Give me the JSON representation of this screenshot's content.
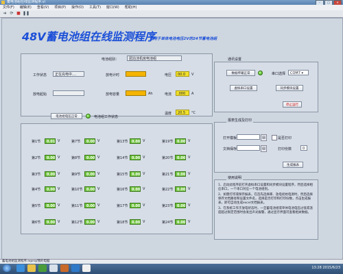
{
  "window": {
    "title": "蓄电池组在线监测程序.vi"
  },
  "menu": [
    "文件(F)",
    "编辑(E)",
    "查看(V)",
    "项目(P)",
    "操作(O)",
    "工具(T)",
    "窗口(W)",
    "帮助(H)"
  ],
  "header": {
    "title": "48V蓄电池组在线监测程序",
    "subtitle": "适用于单体电池电压2V的24节蓄电池组"
  },
  "battery_group": {
    "label": "电池组别：",
    "value": "团泊洼机房电池组"
  },
  "status": {
    "work_status_label": "工作状态",
    "work_status_value": "正在充电中....",
    "discharge_start_label": "放电起始",
    "discharge_timer_label": "放电计时",
    "discharge_capacity_label": "放电容量",
    "discharge_capacity_unit": "Ah",
    "voltage_label": "电压",
    "voltage_value": "00.0",
    "voltage_unit": "V",
    "current_label": "电流",
    "current_value": ".000",
    "current_unit": "A",
    "temp_label": "温度",
    "temp_value": "20.5",
    "temp_unit": "°C",
    "normal_button": "电池组电压正常",
    "work_state_text": "电池组工作状态"
  },
  "cells": [
    {
      "label": "第1节",
      "value": "0.01",
      "unit": "V"
    },
    {
      "label": "第2节",
      "value": "0.00",
      "unit": "V"
    },
    {
      "label": "第3节",
      "value": "0.00",
      "unit": "V"
    },
    {
      "label": "第4节",
      "value": "0.00",
      "unit": "V"
    },
    {
      "label": "第5节",
      "value": "0.00",
      "unit": "V"
    },
    {
      "label": "第6节",
      "value": "0.00",
      "unit": "V"
    },
    {
      "label": "第7节",
      "value": "0.00",
      "unit": "V"
    },
    {
      "label": "第8节",
      "value": "0.00",
      "unit": "V"
    },
    {
      "label": "第9节",
      "value": "0.00",
      "unit": "V"
    },
    {
      "label": "第10节",
      "value": "0.00",
      "unit": "V"
    },
    {
      "label": "第11节",
      "value": "0.00",
      "unit": "V"
    },
    {
      "label": "第12节",
      "value": "0.00",
      "unit": "V"
    },
    {
      "label": "第13节",
      "value": "0.00",
      "unit": "V"
    },
    {
      "label": "第14节",
      "value": "0.00",
      "unit": "V"
    },
    {
      "label": "第15节",
      "value": "0.00",
      "unit": "V"
    },
    {
      "label": "第16节",
      "value": "0.00",
      "unit": "V"
    },
    {
      "label": "第17节",
      "value": "0.00",
      "unit": "V"
    },
    {
      "label": "第18节",
      "value": "0.00",
      "unit": "V"
    },
    {
      "label": "第19节",
      "value": "0.00",
      "unit": "V"
    },
    {
      "label": "第20节",
      "value": "0.00",
      "unit": "V"
    },
    {
      "label": "第21节",
      "value": "0.00",
      "unit": "V"
    },
    {
      "label": "第22节",
      "value": "0.00",
      "unit": "V"
    },
    {
      "label": "第23节",
      "value": "0.00",
      "unit": "V"
    },
    {
      "label": "第24节",
      "value": "0.00",
      "unit": "V"
    }
  ],
  "comm": {
    "title": "通讯设置",
    "data_status_button": "数据传输正常",
    "port_label": "串口选择",
    "port_value": "COM7",
    "virtual_port_button": "虚拟串口设置",
    "sync_button": "同步模块设置",
    "stop_button": "停止运行"
  },
  "report": {
    "title": "报表生成及打印",
    "template_label": "打开模板",
    "save_label": "文档保存",
    "print_label": "是否打印",
    "copies_label": "打印份数",
    "copies_value": "0",
    "generate_button": "生成报表"
  },
  "help": {
    "title": "使用说明",
    "lines": [
      "1、启动此程序前打开虚拟串口设置和同步模块设置程序，然后选择相应串口，一个串口对应一个电池组别。",
      "2、如需打印或保存报表，在首先选择库、放电初始电源时，然后选择保存文档路径和设置文件名，选择是否打印和打印份数，点击生成报表，即可自动生成excel文档报表。",
      "3、在系统工作于放电状态时，一旦蓄电池组或单体电池电压过低或温度超过限定范围时会发出声光报警，通过显示界面可查看相关数据。"
    ]
  },
  "statusbar": {
    "text": "蓄电池组监测程序.lvproj/我的电脑"
  },
  "taskbar": {
    "time": "13:28",
    "date": "2015/6/23"
  }
}
